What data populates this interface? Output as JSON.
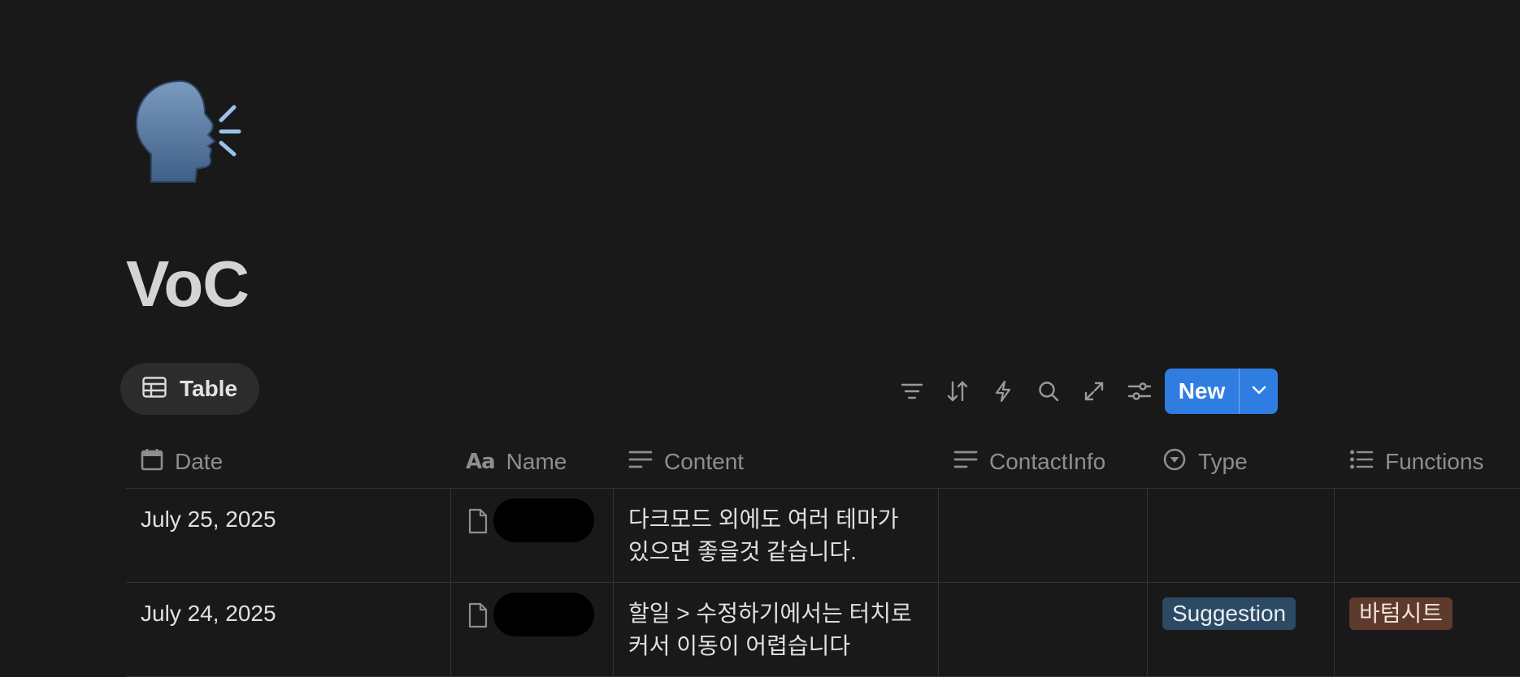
{
  "page": {
    "icon": "speaking-head-icon",
    "title": "VoC"
  },
  "view_tab": {
    "label": "Table",
    "icon": "table-icon"
  },
  "toolbar": {
    "icons": [
      "filter-icon",
      "sort-icon",
      "automation-bolt-icon",
      "search-icon",
      "expand-icon",
      "settings-sliders-icon"
    ],
    "new_label": "New"
  },
  "table": {
    "columns": [
      {
        "label": "Date",
        "icon": "calendar-icon"
      },
      {
        "label": "Name",
        "icon": "title-aa-icon"
      },
      {
        "label": "Content",
        "icon": "text-lines-icon"
      },
      {
        "label": "ContactInfo",
        "icon": "text-lines-icon"
      },
      {
        "label": "Type",
        "icon": "select-icon"
      },
      {
        "label": "Functions",
        "icon": "multi-select-list-icon"
      }
    ],
    "rows": [
      {
        "date": "July 25, 2025",
        "name": "",
        "content": "다크모드 외에도 여러 테마가 있으면 좋을것 같습니다.",
        "contact": "",
        "type": "",
        "functions": ""
      },
      {
        "date": "July 24, 2025",
        "name": "",
        "content": "할일 > 수정하기에서는 터치로 커서 이동이 어렵습니다",
        "contact": "",
        "type": "Suggestion",
        "functions": "바텀시트"
      }
    ]
  },
  "colors": {
    "background": "#191919",
    "accent": "#2f7de1",
    "type_tag": "#2c4a63",
    "function_tag": "#5e3a2c"
  }
}
